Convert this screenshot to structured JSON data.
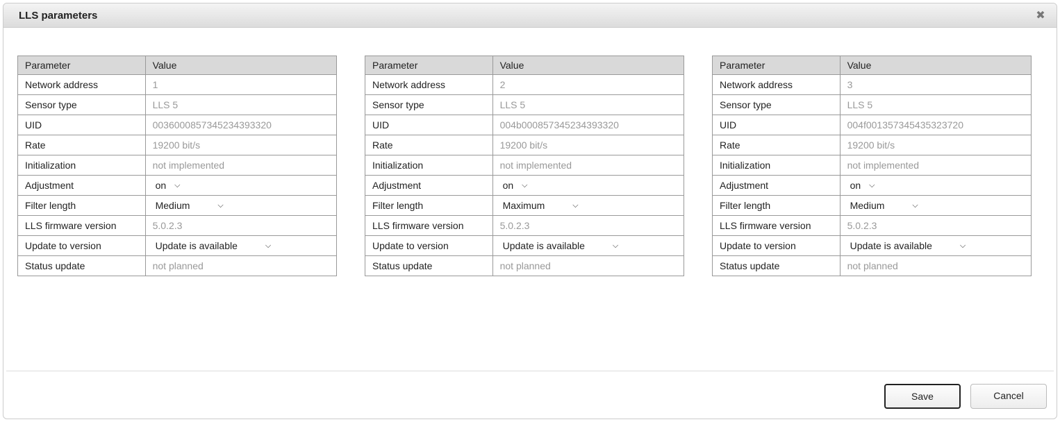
{
  "dialog": {
    "title": "LLS parameters",
    "save_label": "Save",
    "cancel_label": "Cancel"
  },
  "headers": {
    "param": "Parameter",
    "value": "Value"
  },
  "labels": {
    "net": "Network address",
    "sensor": "Sensor type",
    "uid": "UID",
    "rate": "Rate",
    "init": "Initialization",
    "adj": "Adjustment",
    "flen": "Filter length",
    "fw": "LLS firmware version",
    "upd": "Update to version",
    "status": "Status update"
  },
  "t1": {
    "net": "1",
    "sensor": "LLS 5",
    "uid": "0036000857345234393320",
    "rate": "19200 bit/s",
    "init": "not implemented",
    "adj": "on",
    "flen": "Medium",
    "fw": "5.0.2.3",
    "upd": "Update is available",
    "status": "not planned"
  },
  "t2": {
    "net": "2",
    "sensor": "LLS 5",
    "uid": "004b000857345234393320",
    "rate": "19200 bit/s",
    "init": "not implemented",
    "adj": "on",
    "flen": "Maximum",
    "fw": "5.0.2.3",
    "upd": "Update is available",
    "status": "not planned"
  },
  "t3": {
    "net": "3",
    "sensor": "LLS 5",
    "uid": "004f001357345435323720",
    "rate": "19200 bit/s",
    "init": "not implemented",
    "adj": "on",
    "flen": "Medium",
    "fw": "5.0.2.3",
    "upd": "Update is available",
    "status": "not planned"
  }
}
